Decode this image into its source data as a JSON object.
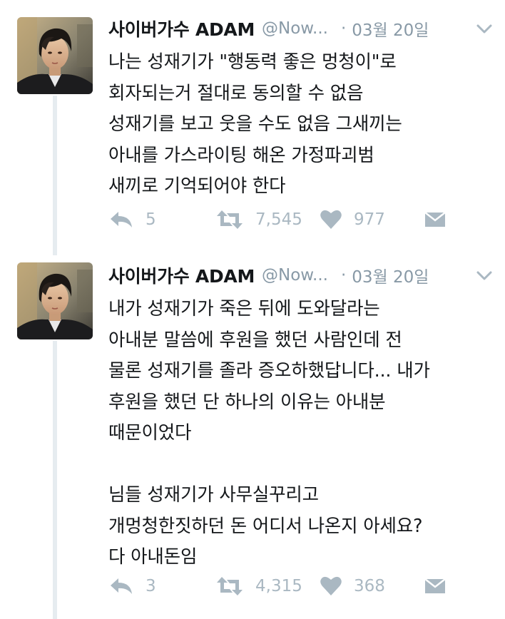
{
  "tweets": [
    {
      "author": "사이버가수 ADAM",
      "handle": "@Now...",
      "separator": "·",
      "date": "03월 20일",
      "text": "나는 성재기가 \"행동력 좋은 멍청이\"로\n회자되는거 절대로 동의할 수 없음\n성재기를 보고 웃을 수도 없음 그새끼는\n아내를 가스라이팅 해온 가정파괴범\n새끼로 기억되어야 한다",
      "replies": "5",
      "retweets": "7,545",
      "likes": "977"
    },
    {
      "author": "사이버가수 ADAM",
      "handle": "@Now...",
      "separator": "·",
      "date": "03월 20일",
      "text": "내가 성재기가 죽은 뒤에 도와달라는\n아내분 말씀에 후원을 했던 사람인데 전\n물론 성재기를 졸라 증오하했답니다... 내가\n후원을 했던 단 하나의 이유는 아내분\n때문이었다\n\n님들 성재기가 사무실꾸리고\n개멍청한짓하던 돈 어디서 나온지 아세요?\n다 아내돈임",
      "replies": "3",
      "retweets": "4,315",
      "likes": "368"
    }
  ],
  "icons": {
    "reply": "reply-icon",
    "retweet": "retweet-icon",
    "like": "heart-icon",
    "dm": "envelope-icon",
    "more": "chevron-down-icon"
  },
  "colors": {
    "name": "#14171a",
    "meta": "#8899a6",
    "action": "#aab8c2",
    "thread_line": "#e6ecf0"
  }
}
